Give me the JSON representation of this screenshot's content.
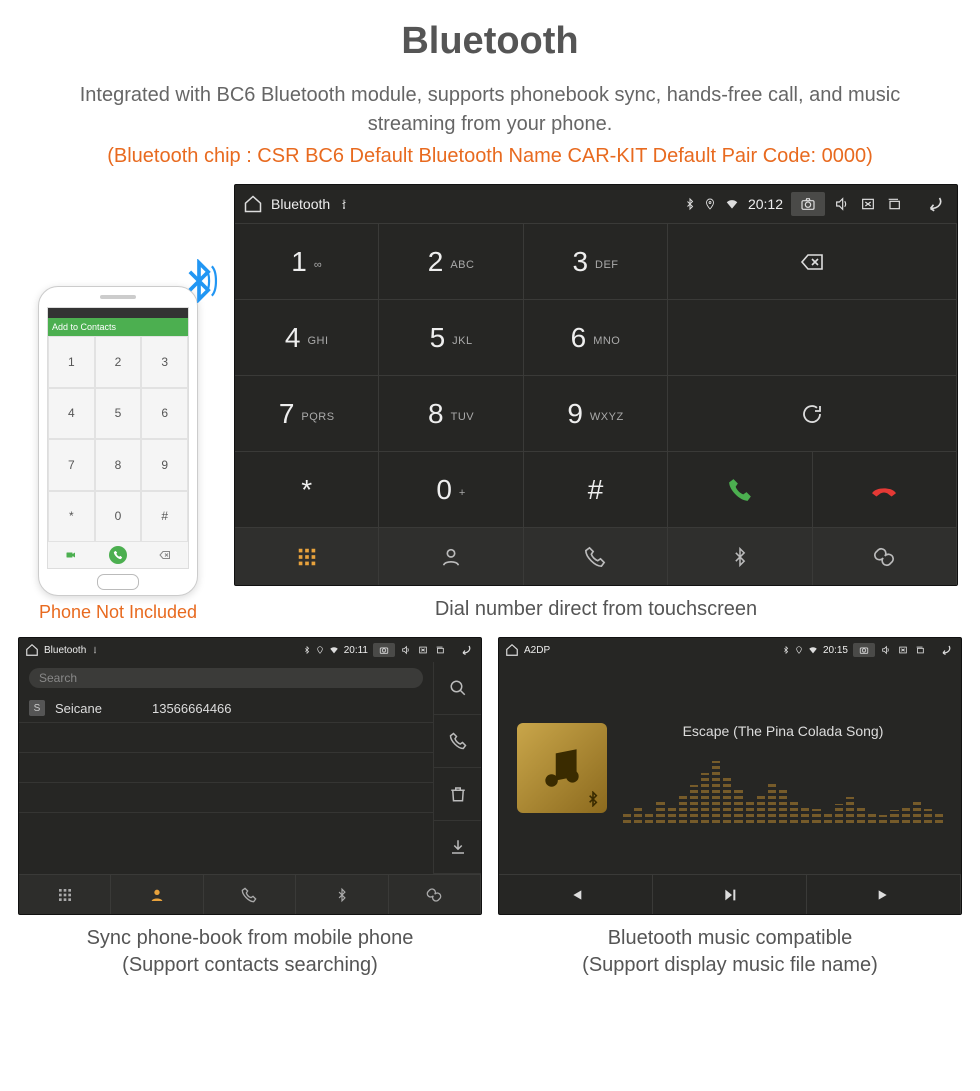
{
  "header": {
    "title": "Bluetooth",
    "subtitle": "Integrated with BC6 Bluetooth module, supports phonebook sync, hands-free call, and music streaming from your phone.",
    "specs": "(Bluetooth chip : CSR BC6     Default Bluetooth Name CAR-KIT     Default Pair Code: 0000)"
  },
  "phone": {
    "bar": "Add to Contacts",
    "caption": "Phone Not Included",
    "keys": [
      "1",
      "2",
      "3",
      "4",
      "5",
      "6",
      "7",
      "8",
      "9",
      "*",
      "0",
      "#"
    ]
  },
  "main": {
    "app_title": "Bluetooth",
    "clock": "20:12",
    "keys": [
      {
        "n": "1",
        "l": "∞"
      },
      {
        "n": "2",
        "l": "ABC"
      },
      {
        "n": "3",
        "l": "DEF"
      },
      {
        "n": "4",
        "l": "GHI"
      },
      {
        "n": "5",
        "l": "JKL"
      },
      {
        "n": "6",
        "l": "MNO"
      },
      {
        "n": "7",
        "l": "PQRS"
      },
      {
        "n": "8",
        "l": "TUV"
      },
      {
        "n": "9",
        "l": "WXYZ"
      },
      {
        "n": "*",
        "l": ""
      },
      {
        "n": "0",
        "l": "+"
      },
      {
        "n": "#",
        "l": ""
      }
    ],
    "caption": "Dial number direct from touchscreen"
  },
  "phonebook": {
    "app_title": "Bluetooth",
    "clock": "20:11",
    "search_placeholder": "Search",
    "contact_badge": "S",
    "contact_name": "Seicane",
    "contact_number": "13566664466",
    "caption_l1": "Sync phone-book from mobile phone",
    "caption_l2": "(Support contacts searching)"
  },
  "a2dp": {
    "app_title": "A2DP",
    "clock": "20:15",
    "track": "Escape (The Pina Colada Song)",
    "caption_l1": "Bluetooth music compatible",
    "caption_l2": "(Support display music file name)"
  }
}
